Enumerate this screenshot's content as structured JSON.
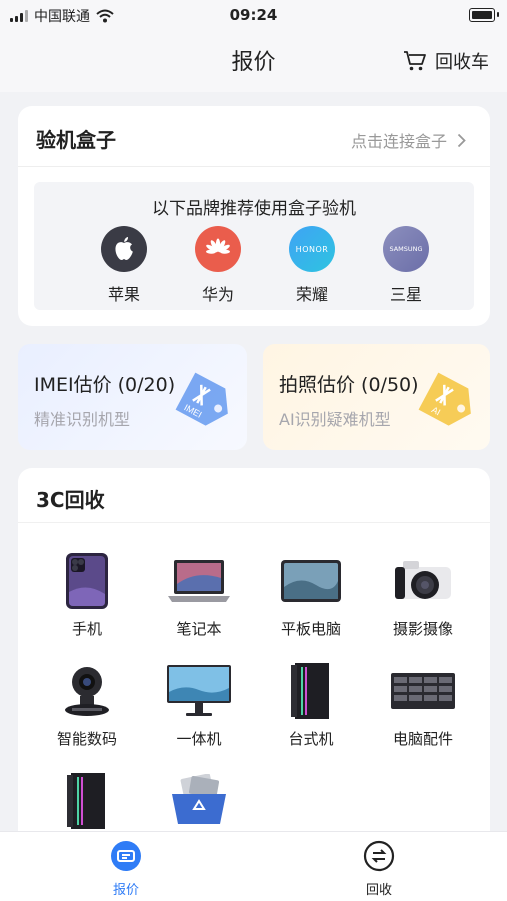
{
  "status_bar": {
    "carrier": "中国联通",
    "time": "09:24"
  },
  "nav": {
    "title": "报价",
    "cart_label": "回收车"
  },
  "box_card": {
    "title": "验机盒子",
    "connect_label": "点击连接盒子",
    "panel_heading": "以下品牌推荐使用盒子验机",
    "brands": [
      {
        "name": "苹果",
        "icon": "apple-logo"
      },
      {
        "name": "华为",
        "icon": "huawei-logo"
      },
      {
        "name": "荣耀",
        "icon": "honor-logo",
        "logo_text": "HONOR"
      },
      {
        "name": "三星",
        "icon": "samsung-logo",
        "logo_text": "SAMSUNG"
      }
    ]
  },
  "estimates": [
    {
      "title": "IMEI估价 (0/20)",
      "subtitle": "精准识别机型",
      "tag_text": "IMEI",
      "color": "#6d9ff1"
    },
    {
      "title": "拍照估价 (0/50)",
      "subtitle": "AI识别疑难机型",
      "tag_text": "AI",
      "color": "#f5c746"
    }
  ],
  "recycle": {
    "title": "3C回收",
    "items": [
      {
        "label": "手机",
        "icon": "phone-icon"
      },
      {
        "label": "笔记本",
        "icon": "laptop-icon"
      },
      {
        "label": "平板电脑",
        "icon": "tablet-icon"
      },
      {
        "label": "摄影摄像",
        "icon": "camera-icon"
      },
      {
        "label": "智能数码",
        "icon": "webcam-icon"
      },
      {
        "label": "一体机",
        "icon": "monitor-icon"
      },
      {
        "label": "台式机",
        "icon": "desktop-tower-icon"
      },
      {
        "label": "电脑配件",
        "icon": "server-icon"
      },
      {
        "label": "",
        "icon": "desktop-tower-icon"
      },
      {
        "label": "",
        "icon": "recycle-bin-icon"
      }
    ]
  },
  "tabbar": {
    "items": [
      {
        "label": "报价",
        "active": true
      },
      {
        "label": "回收",
        "active": false
      }
    ],
    "active_color": "#2f7cf6"
  }
}
